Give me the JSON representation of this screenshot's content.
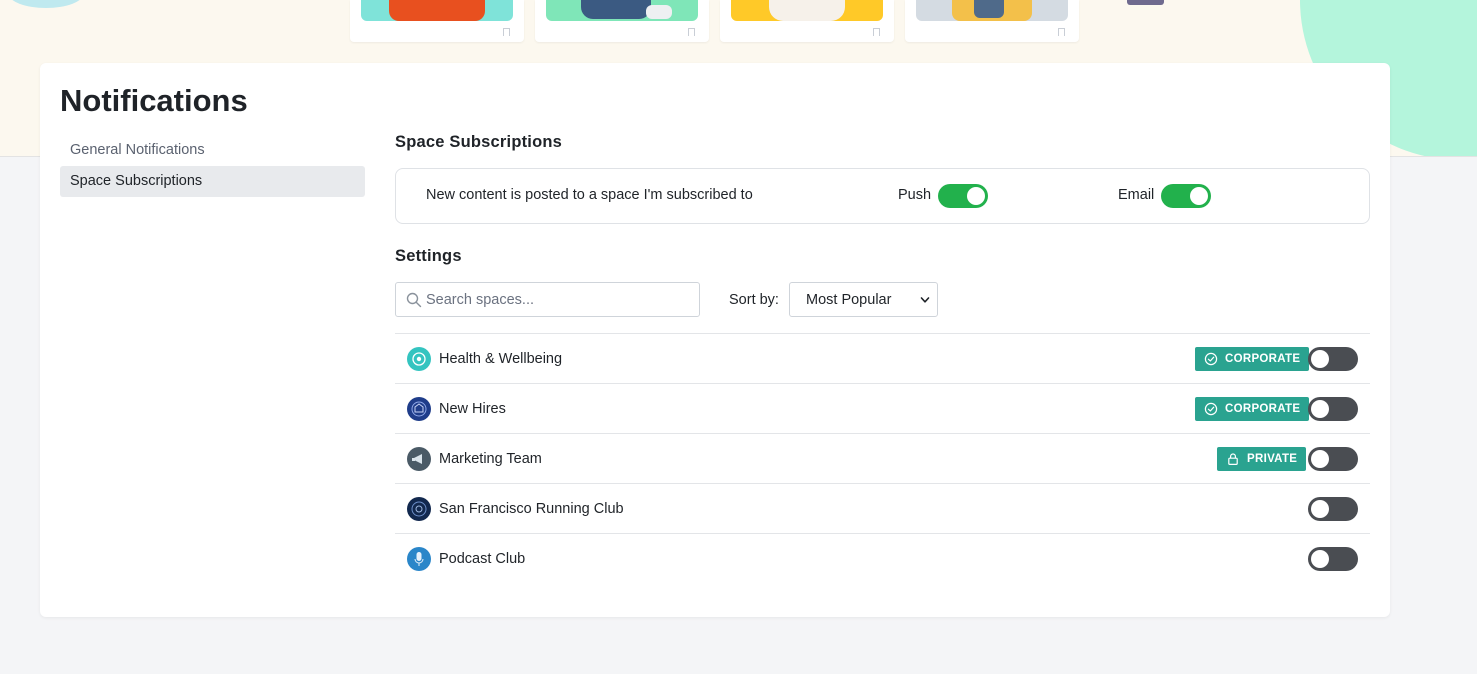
{
  "page": {
    "title": "Notifications"
  },
  "sidebar": {
    "items": [
      {
        "label": "General Notifications"
      },
      {
        "label": "Space Subscriptions"
      }
    ]
  },
  "subscriptions": {
    "title": "Space Subscriptions",
    "row_text": "New content is posted to a space I'm subscribed to",
    "push_label": "Push",
    "push_on": true,
    "email_label": "Email",
    "email_on": true
  },
  "settings": {
    "title": "Settings",
    "search_placeholder": "Search spaces...",
    "sort_label": "Sort by:",
    "sort_value": "Most Popular"
  },
  "spaces": [
    {
      "name": "Health & Wellbeing",
      "badge": "CORPORATE",
      "badge_icon": "check-circle-icon",
      "enabled": false,
      "avatar_color": "#34c4c0"
    },
    {
      "name": "New Hires",
      "badge": "CORPORATE",
      "badge_icon": "check-circle-icon",
      "enabled": false,
      "avatar_color": "#1f3d8a"
    },
    {
      "name": "Marketing Team",
      "badge": "PRIVATE",
      "badge_icon": "lock-icon",
      "enabled": false,
      "avatar_color": "#4a5a66"
    },
    {
      "name": "San Francisco Running Club",
      "badge": "",
      "enabled": false,
      "avatar_color": "#12284e"
    },
    {
      "name": "Podcast Club",
      "badge": "",
      "enabled": false,
      "avatar_color": "#2a86c9"
    }
  ],
  "colors": {
    "toggle_on": "#22b14c",
    "toggle_off": "#4a4d52",
    "badge": "#2aa390",
    "hero_bg": "#fcf8ef",
    "hero_accent": "#b4f5dc"
  }
}
